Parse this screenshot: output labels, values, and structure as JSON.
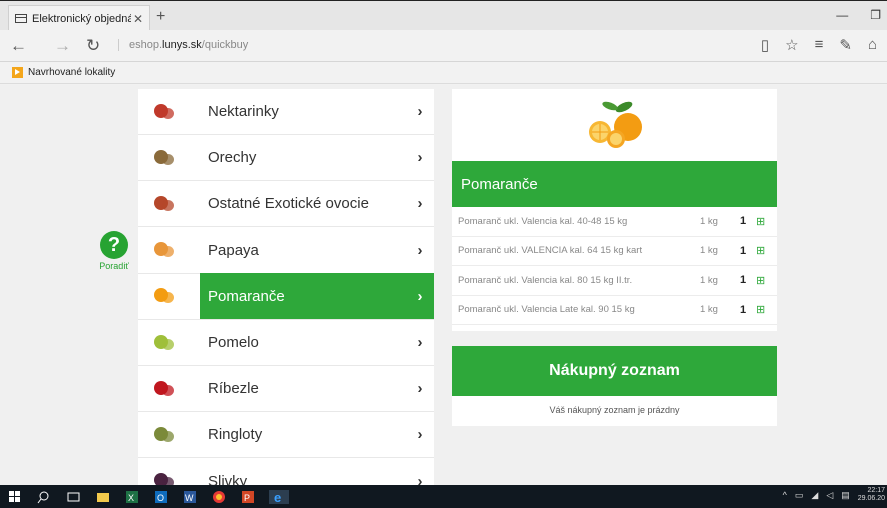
{
  "browser": {
    "tab_title": "Elektronický objednávkc",
    "tab_close": "✕",
    "new_tab": "+",
    "url_prefix": "eshop.",
    "url_domain": "lunys.sk",
    "url_path": "/quickbuy",
    "favorites_label": "Navrhované lokality"
  },
  "help": {
    "icon": "?",
    "label": "Poradiť"
  },
  "categories": [
    {
      "name": "Nektarinky",
      "fruit_color": "#c0392b"
    },
    {
      "name": "Orechy",
      "fruit_color": "#8a6a3a"
    },
    {
      "name": "Ostatné Exotické ovocie",
      "fruit_color": "#b5472a"
    },
    {
      "name": "Papaya",
      "fruit_color": "#e8963a"
    },
    {
      "name": "Pomaranče",
      "fruit_color": "#f39c12",
      "active": true
    },
    {
      "name": "Pomelo",
      "fruit_color": "#9fbf3a"
    },
    {
      "name": "Ríbezle",
      "fruit_color": "#c0171f"
    },
    {
      "name": "Ringloty",
      "fruit_color": "#7b8a3a"
    },
    {
      "name": "Slivky",
      "fruit_color": "#4a2340"
    }
  ],
  "product": {
    "title": "Pomaranče",
    "items": [
      {
        "name": "Pomaranč ukl. Valencia kal. 40-48 15 kg",
        "unit": "1 kg",
        "qty": "1"
      },
      {
        "name": "Pomaranč ukl. VALENCIA kal. 64 15 kg kart",
        "unit": "1 kg",
        "qty": "1"
      },
      {
        "name": "Pomaranč ukl. Valencia kal. 80 15 kg II.tr.",
        "unit": "1 kg",
        "qty": "1"
      },
      {
        "name": "Pomaranč ukl. Valencia Late kal. 90 15 kg",
        "unit": "1 kg",
        "qty": "1"
      }
    ]
  },
  "cart": {
    "title": "Nákupný zoznam",
    "empty_text": "Váš nákupný zoznam je prázdny"
  },
  "taskbar": {
    "clock_time": "22:17",
    "clock_date": "29.06.20"
  },
  "colors": {
    "accent": "#2ea83a"
  }
}
